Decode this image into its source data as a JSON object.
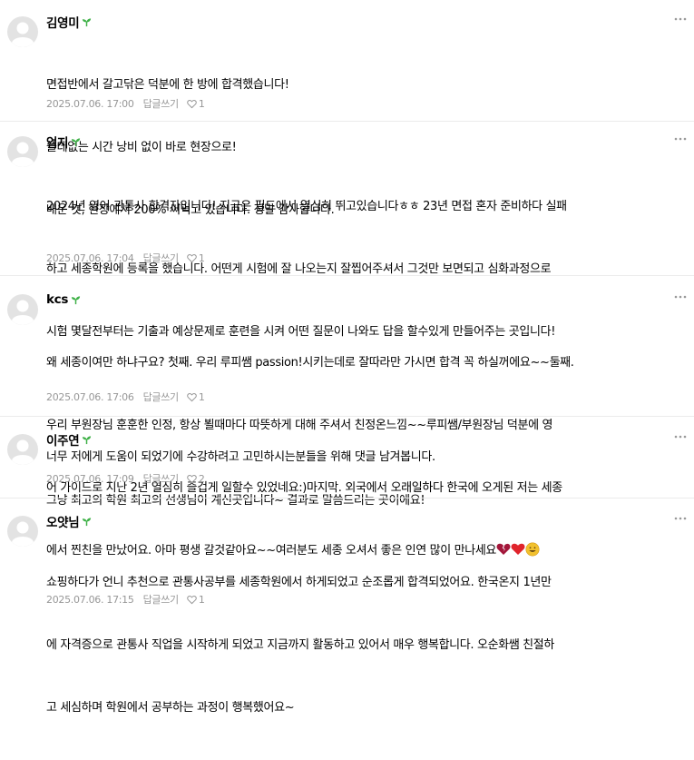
{
  "colors": {
    "author_badge": "#3fb148",
    "meta_text": "#979797",
    "divider": "#ebebeb",
    "avatar_bg": "#dddddd",
    "heart_red": "#e0242c",
    "heart_dark": "#a3163a",
    "smiley": "#f2c12e"
  },
  "comments": [
    {
      "author": "김영미",
      "lines": [
        "면접반에서 갈고닦은 덕분에 한 방에 합격했습니다!",
        "쓸데없는 시간 낭비 없이 바로 현장으로!",
        "배운 것, 현장에서 200% 써먹고 있습니다. 정말 감사합니다."
      ],
      "date": "2025.07.06. 17:00",
      "reply_label": "답글쓰기",
      "likes": "1"
    },
    {
      "author": "엄지",
      "lines": [
        "2024년 영어 관통사 합격자입니다! 지금은 필드에서 열심히 뛰고있습니다ㅎㅎ 23년 면접 혼자 준비하다 실패",
        "하고 세종학원에 등록을 했습니다. 어떤게 시험에 잘 나오는지 잘찝어주셔서 그것만 보면되고 심화과정으로",
        "시험 몇달전부터는 기출과 예상문제로 훈련을 시켜 어떤 질문이 나와도 답을 할수있게 만들어주는 곳입니다!",
        "",
        "너무 저에게 도움이 되었기에 수강하려고 고민하시는분들을 위해 댓글 남겨봅니다."
      ],
      "date": "2025.07.06. 17:04",
      "reply_label": "답글쓰기",
      "likes": "1"
    },
    {
      "author": "kcs",
      "lines": [
        "왜 세종이여만 하냐구요? 첫째. 우리 루피쌤 passion!시키는데로 잘따라만 가시면 합격 꼭 하실꺼에요~~둘째.",
        "우리 부원장님 훈훈한 인정, 항상 뵐때마다 따뜻하게 대해 주셔서 친정온느낌~~루피쌤/부원장님 덕분에 영",
        "어 가이드로 지난 2년 열심히 즐겁게 일할수 있었네요:)마지막. 외국에서 오래일하다 한국에 오게된 저는 세종",
        "에서 찐친을 만났어요. 아마 평생 갈것같아요~~여러분도 세종 오셔서 좋은 인연 많이 만나세요"
      ],
      "date": "2025.07.06. 17:06",
      "reply_label": "답글쓰기",
      "likes": "1"
    },
    {
      "author": "이주연",
      "lines": [
        "그냥 최고의 학원 최고의 선생님이 계신곳입니다~ 결과로 말씀드리는 곳이에요!"
      ],
      "date": "2025.07.06. 17:09",
      "reply_label": "답글쓰기",
      "likes": "2"
    },
    {
      "author": "오얏님",
      "lines": [
        "쇼핑하다가 언니 추천으로 관통사공부를 세종학원에서 하게되었고 순조롭게 합격되었어요. 한국온지 1년만",
        "에 자격증으로 관통사 직업을 시작하게 되었고 지금까지 활동하고 있어서 매우 행복합니다. 오순화쌤 친절하",
        "고 세심하며 학원에서 공부하는 과정이 행복했어요~"
      ],
      "date": "2025.07.06. 17:15",
      "reply_label": "답글쓰기",
      "likes": "1"
    }
  ],
  "icons": {
    "avatar": "default-profile-icon",
    "badge": "sprout-icon",
    "more": "more-options-icon",
    "like": "heart-outline-icon"
  }
}
